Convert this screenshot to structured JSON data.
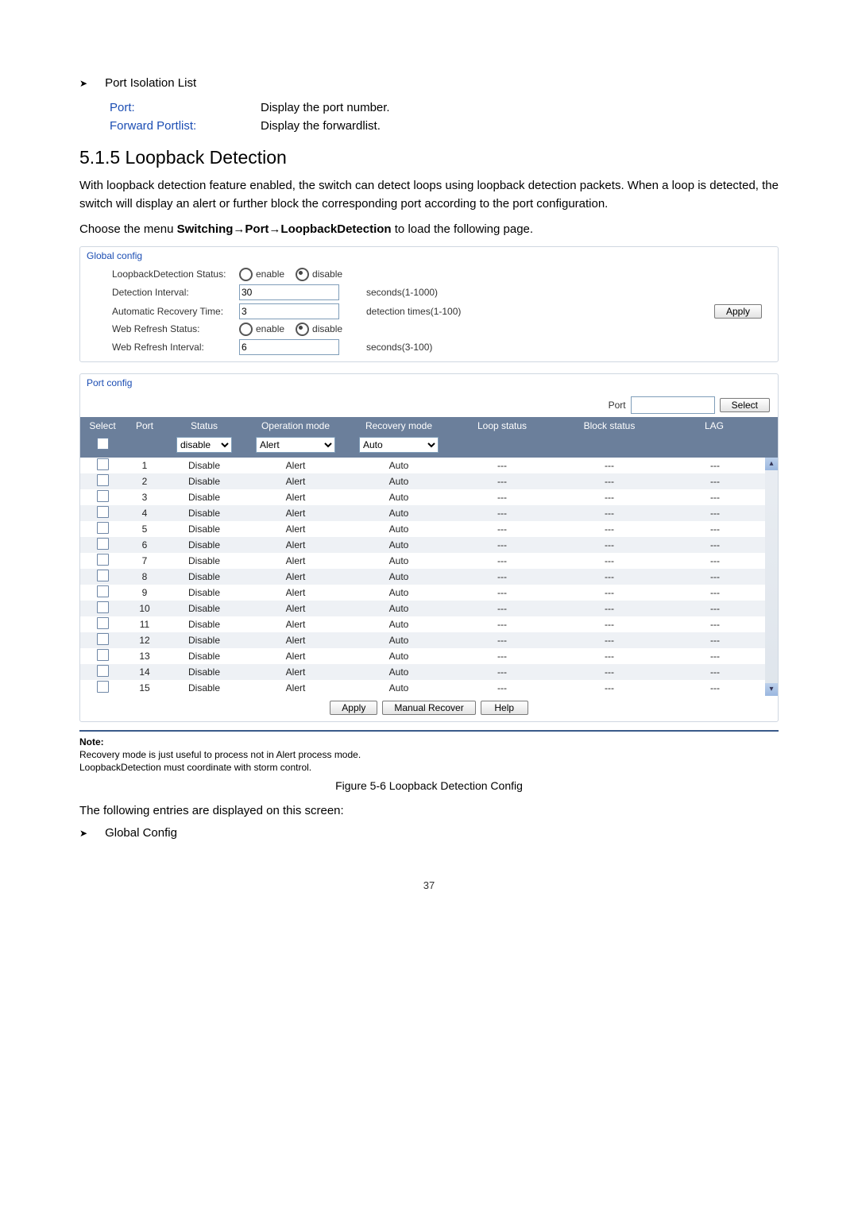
{
  "bullet1": "Port Isolation List",
  "defs": [
    {
      "term": "Port:",
      "desc": "Display the port number."
    },
    {
      "term": "Forward Portlist:",
      "desc": "Display the forwardlist."
    }
  ],
  "sectionHeading": "5.1.5 Loopback Detection",
  "para1": "With loopback detection feature enabled, the switch can detect loops using loopback detection packets. When a loop is detected, the switch will display an alert or further block the corresponding port according to the port configuration.",
  "para2a": "Choose the menu ",
  "para2b": "Switching→Port→LoopbackDetection",
  "para2c": " to load the following page.",
  "globalConfig": {
    "title": "Global config",
    "rows": {
      "loopbackLabel": "LoopbackDetection Status:",
      "enable": "enable",
      "disable": "disable",
      "detIntLabel": "Detection Interval:",
      "detIntVal": "30",
      "detIntHint": "seconds(1-1000)",
      "autoRecLabel": "Automatic Recovery Time:",
      "autoRecVal": "3",
      "autoRecHint": "detection times(1-100)",
      "webRefLabel": "Web Refresh Status:",
      "webRefIntLabel": "Web Refresh Interval:",
      "webRefIntVal": "6",
      "webRefIntHint": "seconds(3-100)"
    },
    "applyBtn": "Apply"
  },
  "portConfig": {
    "title": "Port config",
    "portLabel": "Port",
    "selectBtn": "Select",
    "headers": {
      "select": "Select",
      "port": "Port",
      "status": "Status",
      "op": "Operation mode",
      "rec": "Recovery mode",
      "loop": "Loop status",
      "block": "Block status",
      "lag": "LAG"
    },
    "filters": {
      "status": "disable",
      "op": "Alert",
      "rec": "Auto"
    },
    "rows": [
      {
        "port": "1",
        "status": "Disable",
        "op": "Alert",
        "rec": "Auto",
        "loop": "---",
        "block": "---",
        "lag": "---"
      },
      {
        "port": "2",
        "status": "Disable",
        "op": "Alert",
        "rec": "Auto",
        "loop": "---",
        "block": "---",
        "lag": "---"
      },
      {
        "port": "3",
        "status": "Disable",
        "op": "Alert",
        "rec": "Auto",
        "loop": "---",
        "block": "---",
        "lag": "---"
      },
      {
        "port": "4",
        "status": "Disable",
        "op": "Alert",
        "rec": "Auto",
        "loop": "---",
        "block": "---",
        "lag": "---"
      },
      {
        "port": "5",
        "status": "Disable",
        "op": "Alert",
        "rec": "Auto",
        "loop": "---",
        "block": "---",
        "lag": "---"
      },
      {
        "port": "6",
        "status": "Disable",
        "op": "Alert",
        "rec": "Auto",
        "loop": "---",
        "block": "---",
        "lag": "---"
      },
      {
        "port": "7",
        "status": "Disable",
        "op": "Alert",
        "rec": "Auto",
        "loop": "---",
        "block": "---",
        "lag": "---"
      },
      {
        "port": "8",
        "status": "Disable",
        "op": "Alert",
        "rec": "Auto",
        "loop": "---",
        "block": "---",
        "lag": "---"
      },
      {
        "port": "9",
        "status": "Disable",
        "op": "Alert",
        "rec": "Auto",
        "loop": "---",
        "block": "---",
        "lag": "---"
      },
      {
        "port": "10",
        "status": "Disable",
        "op": "Alert",
        "rec": "Auto",
        "loop": "---",
        "block": "---",
        "lag": "---"
      },
      {
        "port": "11",
        "status": "Disable",
        "op": "Alert",
        "rec": "Auto",
        "loop": "---",
        "block": "---",
        "lag": "---"
      },
      {
        "port": "12",
        "status": "Disable",
        "op": "Alert",
        "rec": "Auto",
        "loop": "---",
        "block": "---",
        "lag": "---"
      },
      {
        "port": "13",
        "status": "Disable",
        "op": "Alert",
        "rec": "Auto",
        "loop": "---",
        "block": "---",
        "lag": "---"
      },
      {
        "port": "14",
        "status": "Disable",
        "op": "Alert",
        "rec": "Auto",
        "loop": "---",
        "block": "---",
        "lag": "---"
      },
      {
        "port": "15",
        "status": "Disable",
        "op": "Alert",
        "rec": "Auto",
        "loop": "---",
        "block": "---",
        "lag": "---"
      }
    ],
    "buttons": {
      "apply": "Apply",
      "manual": "Manual Recover",
      "help": "Help"
    }
  },
  "noteHdr": "Note:",
  "note1": "Recovery mode is just useful to process not in Alert process mode.",
  "note2": "LoopbackDetection must coordinate with storm control.",
  "figcap": "Figure 5-6 Loopback Detection Config",
  "closing": "The following entries are displayed on this screen:",
  "bullet2": "Global Config",
  "pagenum": "37"
}
